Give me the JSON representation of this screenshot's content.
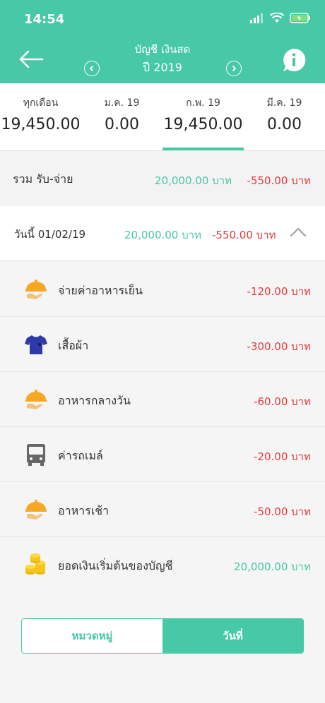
{
  "status": {
    "time": "14:54",
    "icons": [
      "signal-icon",
      "wifi-icon",
      "battery-icon"
    ]
  },
  "header": {
    "title": "บัญชี เงินสด",
    "year": "ปี 2019",
    "icons": [
      "back-arrow-icon",
      "prev-icon",
      "next-icon",
      "info-icon"
    ]
  },
  "months": [
    {
      "label": "ทุกเดือน",
      "value": "19,450.00"
    },
    {
      "label": "ม.ค. 19",
      "value": "0.00"
    },
    {
      "label": "ก.พ. 19",
      "value": "19,450.00"
    },
    {
      "label": "มี.ค. 19",
      "value": "0.00"
    }
  ],
  "selected_month": "ก.พ. 19",
  "summary": {
    "label": "รวม รับ-จ่าย",
    "income": "20,000.00 บาท",
    "expense": "-550.00 บาท"
  },
  "day": {
    "label": "วันนี้ 01/02/19",
    "income": "20,000.00 บาท",
    "expense": "-550.00 บาท",
    "icon": "chevron-up-icon"
  },
  "items": [
    {
      "name": "จ่ายค่าอาหารเย็น",
      "amount": "-120.00 บาท",
      "icon": "food-tray-icon"
    },
    {
      "name": "เสื้อผ้า",
      "amount": "-300.00 บาท",
      "icon": "shirt-icon"
    },
    {
      "name": "อาหารกลางวัน",
      "amount": "-60.00 บาท",
      "icon": "food-tray-icon"
    },
    {
      "name": "ค่ารถเมล์",
      "amount": "-20.00 บาท",
      "icon": "bus-icon"
    },
    {
      "name": "อาหารเช้า",
      "amount": "-50.00 บาท",
      "icon": "food-tray-icon"
    },
    {
      "name": "ยอดเงินเริ่มต้นของบัญชี",
      "amount": "20,000.00 บาท",
      "icon": "coins-icon"
    }
  ],
  "toggle": {
    "category": "หมวดหมู่",
    "date": "วันที่",
    "active": "วันที่"
  },
  "colors": {
    "accent": "#47c8a7",
    "expense": "#e53b3b",
    "income": "#47c8a7"
  }
}
